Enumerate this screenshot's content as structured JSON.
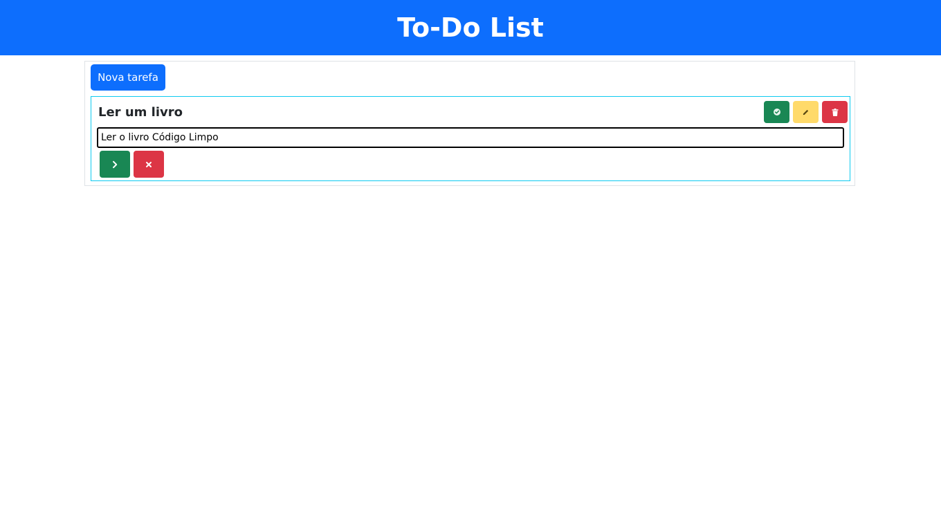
{
  "header": {
    "title": "To-Do List",
    "background": "#0d6efd"
  },
  "toolbar": {
    "new_task_label": "Nova tarefa"
  },
  "task": {
    "title": "Ler um livro",
    "description_value": "Ler o livro Código Limpo",
    "actions": [
      {
        "name": "complete",
        "icon": "check-circle-icon",
        "color": "#198754"
      },
      {
        "name": "edit",
        "icon": "pencil-icon",
        "color": "#ffda6a"
      },
      {
        "name": "delete",
        "icon": "trash-icon",
        "color": "#dc3545"
      }
    ],
    "form_actions": [
      {
        "name": "confirm",
        "icon": "chevron-right-icon",
        "color": "#198754"
      },
      {
        "name": "cancel",
        "icon": "close-icon",
        "color": "#dc3545"
      }
    ],
    "border_color": "#0dcaf0"
  }
}
